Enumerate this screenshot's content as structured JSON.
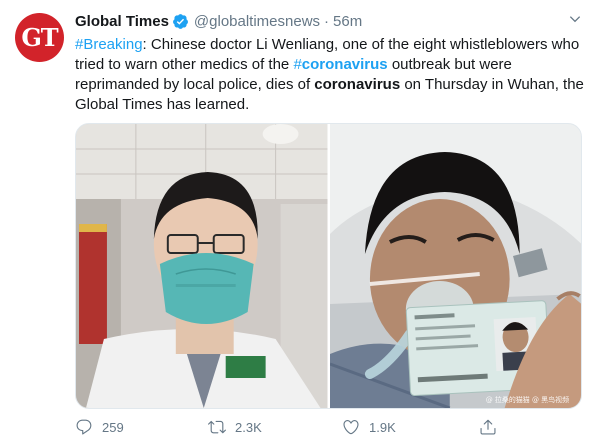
{
  "author": {
    "avatar_text": "GT",
    "name": "Global Times",
    "handle": "@globaltimesnews",
    "separator": "·",
    "time": "56m"
  },
  "tweet": {
    "t1": "#Breaking",
    "t2": ": Chinese doctor Li Wenliang, one of the eight whistleblowers who tried to warn other medics of the ",
    "t3a": "#",
    "t3b": "coronavirus",
    "t4": " outbreak but were reprimanded by local police, dies of ",
    "t5": "coronavirus",
    "t6": " on Thursday in Wuhan, the Global Times has learned."
  },
  "media": {
    "watermark": "@ 拉桑的猫猫  @ 黑鸟视频"
  },
  "actions": {
    "reply_count": "259",
    "retweet_count": "2.3K",
    "like_count": "1.9K"
  },
  "colors": {
    "accent": "#1da1f2",
    "avatar": "#d2232a",
    "muted": "#657786"
  }
}
